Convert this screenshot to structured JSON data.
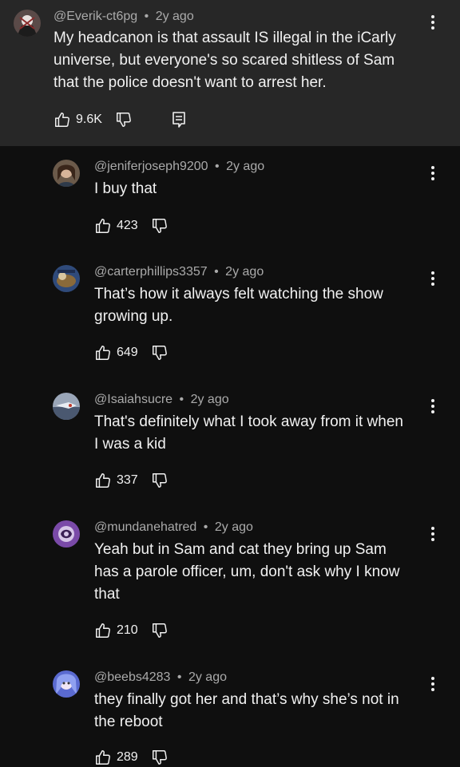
{
  "comments": [
    {
      "handle": "@Everik-ct6pg",
      "sep": "•",
      "time": "2y ago",
      "text": "My headcanon is that assault IS illegal in the iCarly\nuniverse, but everyone's so scared shitless of Sam\nthat the police doesn't want to arrest her.",
      "likes": "9.6K"
    },
    {
      "handle": "@jeniferjoseph9200",
      "sep": "•",
      "time": "2y ago",
      "text": "I buy that",
      "likes": "423"
    },
    {
      "handle": "@carterphillips3357",
      "sep": "•",
      "time": "2y ago",
      "text": "That’s how it always felt watching the show\ngrowing up.",
      "likes": "649"
    },
    {
      "handle": "@Isaiahsucre",
      "sep": "•",
      "time": "2y ago",
      "text": "That's definitely what I took away from it when\nI was a kid",
      "likes": "337"
    },
    {
      "handle": "@mundanehatred",
      "sep": "•",
      "time": "2y ago",
      "text": "Yeah but in Sam and cat they bring up Sam\nhas a parole officer, um, don't ask why I know\nthat",
      "likes": "210"
    },
    {
      "handle": "@beebs4283",
      "sep": "•",
      "time": "2y ago",
      "text": "they finally got her and that’s why she’s not in\nthe reboot",
      "likes": "289"
    }
  ],
  "icons": {
    "like": "thumbs-up-icon",
    "dislike": "thumbs-down-icon",
    "reply": "reply-icon",
    "more": "more-vert-icon"
  },
  "colors": {
    "background": "#0f0f0f",
    "top_comment_bg": "#272727",
    "text": "#f1f1f1",
    "meta": "#aaaaaa"
  }
}
